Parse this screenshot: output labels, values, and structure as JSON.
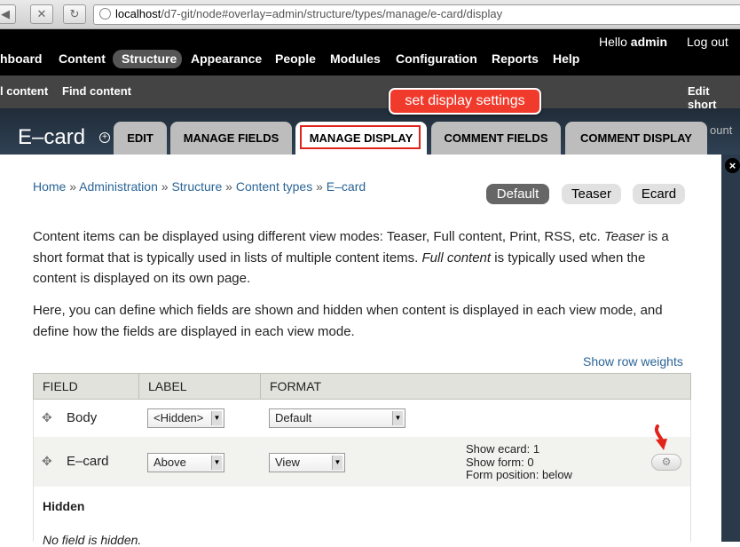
{
  "browser": {
    "url_host": "localhost",
    "url_path": "/d7-git/node#overlay=admin/structure/types/manage/e-card/display",
    "back_glyph": "◀",
    "forward_glyph": "▶",
    "stop_glyph": "✕",
    "reload_glyph": "↻"
  },
  "toolbar": {
    "items": [
      "hboard",
      "Content",
      "Structure",
      "Appearance",
      "People",
      "Modules",
      "Configuration",
      "Reports",
      "Help"
    ],
    "hello_prefix": "Hello ",
    "user": "admin",
    "logout": "Log out"
  },
  "shortcuts": {
    "items": [
      "l content",
      "Find content"
    ],
    "edit": "Edit short"
  },
  "overlay": {
    "title": "E–card",
    "title_plus": "+",
    "tabs": [
      "EDIT",
      "MANAGE FIELDS",
      "MANAGE DISPLAY",
      "COMMENT FIELDS",
      "COMMENT DISPLAY"
    ],
    "tab_overflow": "ount",
    "callout": "set display settings",
    "close": "×"
  },
  "breadcrumb": {
    "items": [
      "Home",
      "Administration",
      "Structure",
      "Content types",
      "E–card"
    ],
    "sep": " » "
  },
  "view_modes": {
    "default": "Default",
    "teaser": "Teaser",
    "ecard": "Ecard"
  },
  "help": {
    "p1_a": "Content items can be displayed using different view modes: Teaser, Full content, Print, RSS, etc. ",
    "p1_teaser": "Teaser",
    "p1_b": " is a short format that is typically used in lists of multiple content items. ",
    "p1_full": "Full content",
    "p1_c": " is typically used when the content is displayed on its own page.",
    "p2": "Here, you can define which fields are shown and hidden when content is displayed in each view mode, and define how the fields are displayed in each view mode."
  },
  "show_row_weights": "Show row weights",
  "table": {
    "headers": [
      "FIELD",
      "LABEL",
      "FORMAT"
    ],
    "rows": [
      {
        "field": "Body",
        "label": "<Hidden>",
        "format": "Default"
      },
      {
        "field": "E–card",
        "label": "Above",
        "format": "View"
      }
    ],
    "summary": [
      "Show ecard: 1",
      "Show form: 0",
      "Form position: below"
    ],
    "hidden_region": "Hidden",
    "no_field": "No field is hidden."
  },
  "icons": {
    "drag": "✥",
    "gear": "⚙",
    "select_arrow": "▼"
  },
  "colors": {
    "toolbar_bg": "#000000",
    "shortcut_bg": "#444444",
    "overlay_bg": "#2b3a4a",
    "link": "#2a6496",
    "callout_red": "#f03a2b"
  }
}
